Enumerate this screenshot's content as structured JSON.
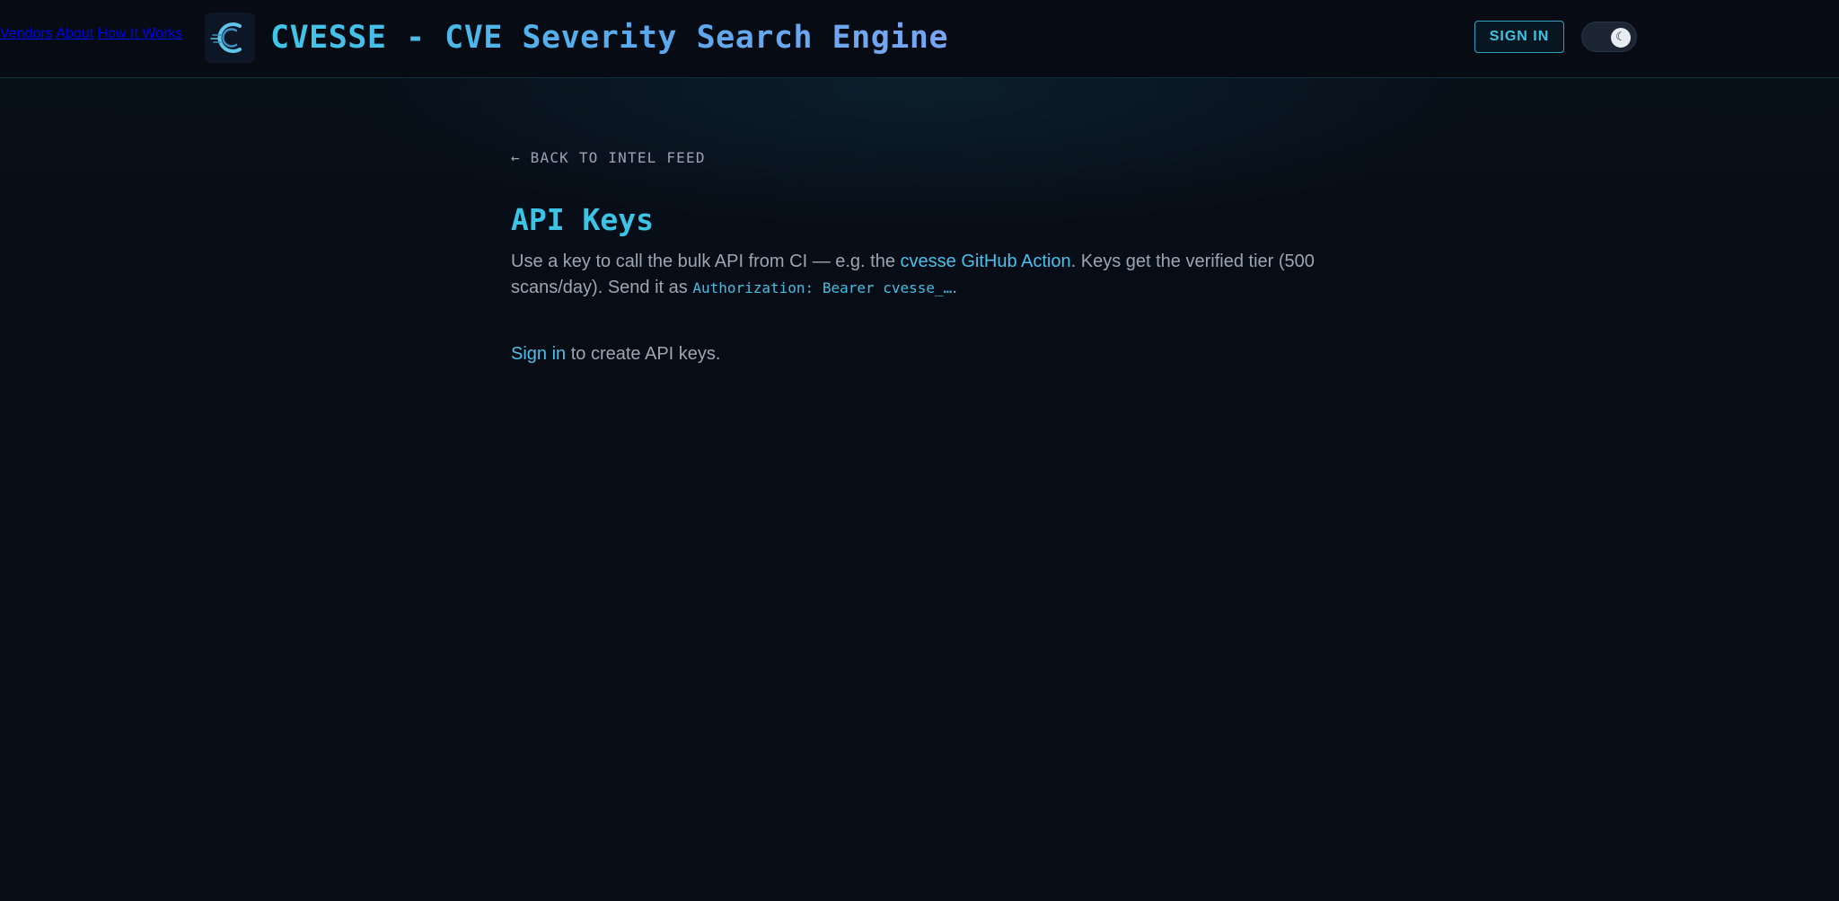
{
  "header": {
    "logo_icon": "cvesse-c-logo-icon",
    "title": "CVESSE - CVE Severity Search Engine",
    "nav": [
      {
        "label": "Vendors"
      },
      {
        "label": "About"
      },
      {
        "label": "How It Works"
      }
    ],
    "sign_in_label": "SIGN IN",
    "theme_toggle": {
      "icon": "moon-icon",
      "glyph": "☾",
      "state": "dark"
    }
  },
  "main": {
    "back_link": "← BACK TO INTEL FEED",
    "title": "API Keys",
    "description": {
      "part1": "Use a key to call the bulk API from CI — e.g. the ",
      "link": "cvesse GitHub Action",
      "part2": ". Keys get the verified tier (500 scans/day). Send it as ",
      "code": "Authorization: Bearer cvesse_…",
      "part3": "."
    },
    "signin_note": {
      "link": "Sign in",
      "text": " to create API keys."
    }
  },
  "colors": {
    "background": "#070b13",
    "accent": "#3dc3e6",
    "link": "#4cc0eb",
    "text_muted": "#9ca6b3"
  }
}
